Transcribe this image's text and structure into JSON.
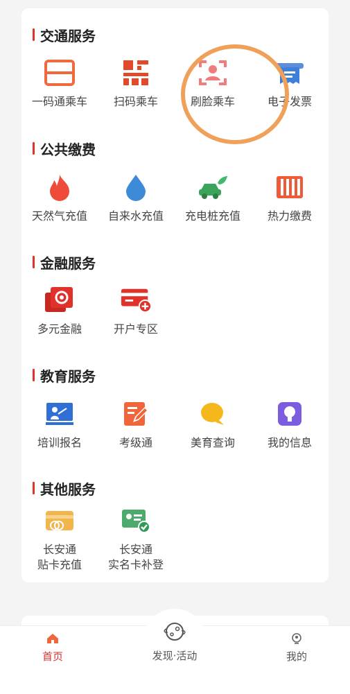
{
  "sections": [
    {
      "title": "交通服务",
      "items": [
        "一码通乘车",
        "扫码乘车",
        "刷脸乘车",
        "电子发票"
      ]
    },
    {
      "title": "公共缴费",
      "items": [
        "天然气充值",
        "自来水充值",
        "充电桩充值",
        "热力缴费"
      ]
    },
    {
      "title": "金融服务",
      "items": [
        "多元金融",
        "开户专区"
      ]
    },
    {
      "title": "教育服务",
      "items": [
        "培训报名",
        "考级通",
        "美育查询",
        "我的信息"
      ]
    },
    {
      "title": "其他服务",
      "items": [
        "长安通\n贴卡充值",
        "长安通\n实名卡补登"
      ]
    }
  ],
  "tabs": [
    {
      "label": "首页",
      "color": "#e0322b"
    },
    {
      "label": "发现·活动",
      "color": "#666666"
    },
    {
      "label": "我的",
      "color": "#666666"
    }
  ],
  "colors": {
    "accent": "#e0322b",
    "highlight_circle": "#f0a159"
  }
}
